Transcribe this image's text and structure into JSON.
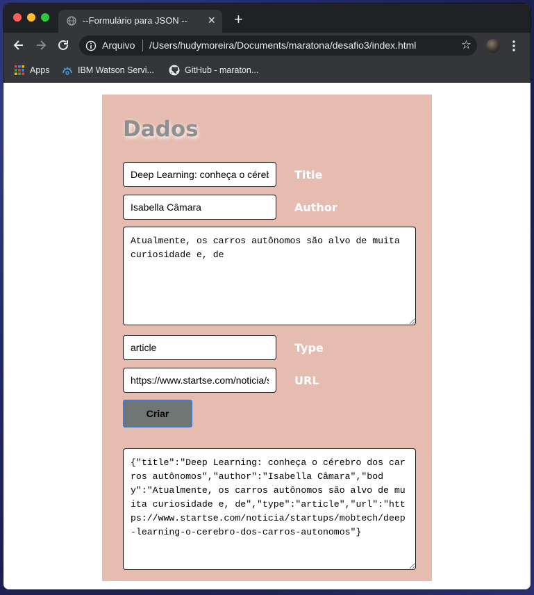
{
  "browser": {
    "tab_title": "--Formulário para JSON --",
    "scheme_label": "Arquivo",
    "url": "/Users/hudymoreira/Documents/maratona/desafio3/index.html",
    "bookmarks": [
      {
        "label": "Apps",
        "icon": "apps-grid-icon"
      },
      {
        "label": "IBM Watson Servi...",
        "icon": "ibm-watson-icon"
      },
      {
        "label": "GitHub - maraton...",
        "icon": "github-icon"
      }
    ]
  },
  "form": {
    "heading": "Dados",
    "title_value": "Deep Learning: conheça o cérebro dos carros autônomos",
    "title_label": "Title",
    "author_value": "Isabella Câmara",
    "author_label": "Author",
    "body_value": "Atualmente, os carros autônomos são alvo de muita curiosidade e, de",
    "type_value": "article",
    "type_label": "Type",
    "url_value": "https://www.startse.com/noticia/startups/mobtech/deep-learning-o-cerebro-dos-carros-autonomos",
    "url_label": "URL",
    "button_label": "Criar",
    "output": "{\"title\":\"Deep Learning: conheça o cérebro dos carros autônomos\",\"author\":\"Isabella Câmara\",\"body\":\"Atualmente, os carros autônomos são alvo de muita curiosidade e, de\",\"type\":\"article\",\"url\":\"https://www.startse.com/noticia/startups/mobtech/deep-learning-o-cerebro-dos-carros-autonomos\"}"
  },
  "colors": {
    "panel": "#e6bcb0",
    "heading": "#8f8f8f",
    "button": "#6f7673",
    "button_focus": "#3d7cd1"
  }
}
